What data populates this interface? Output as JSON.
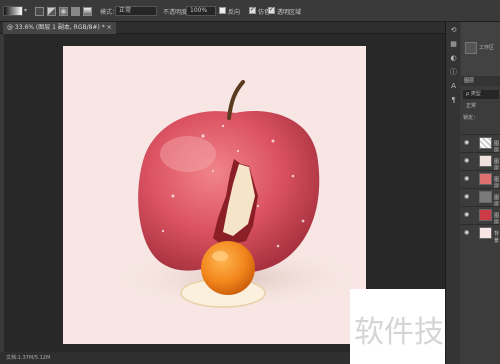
{
  "options_bar": {
    "mode_label": "模式：",
    "mode_value": "正常",
    "opacity_label": "不透明度：",
    "opacity_value": "100%",
    "reverse_label": "反向",
    "dither_label": "仿色",
    "transparency_label": "透明区域"
  },
  "document": {
    "tab_title": "@ 33.6% (图层 1 副本, RGB/8#) * ×"
  },
  "status_bar": {
    "text": "文档:1.37M/5.12M"
  },
  "right_panel": {
    "top_text": "工作区",
    "layers_tab": "图层",
    "kind_filter": "ρ 类型",
    "blend_mode": "正常",
    "lock_label": "锁定："
  },
  "layers": [
    {
      "name": "图层",
      "visible": true
    },
    {
      "name": "图层",
      "visible": true
    },
    {
      "name": "图层",
      "visible": true
    },
    {
      "name": "图层",
      "visible": true
    },
    {
      "name": "图层",
      "visible": true
    },
    {
      "name": "背景",
      "visible": true
    }
  ],
  "watermark": {
    "text": "软件技巧"
  },
  "colors": {
    "canvas_background": "#f7e6e3",
    "apple_red": "#d9505f",
    "yolk_orange": "#f08a1e"
  }
}
